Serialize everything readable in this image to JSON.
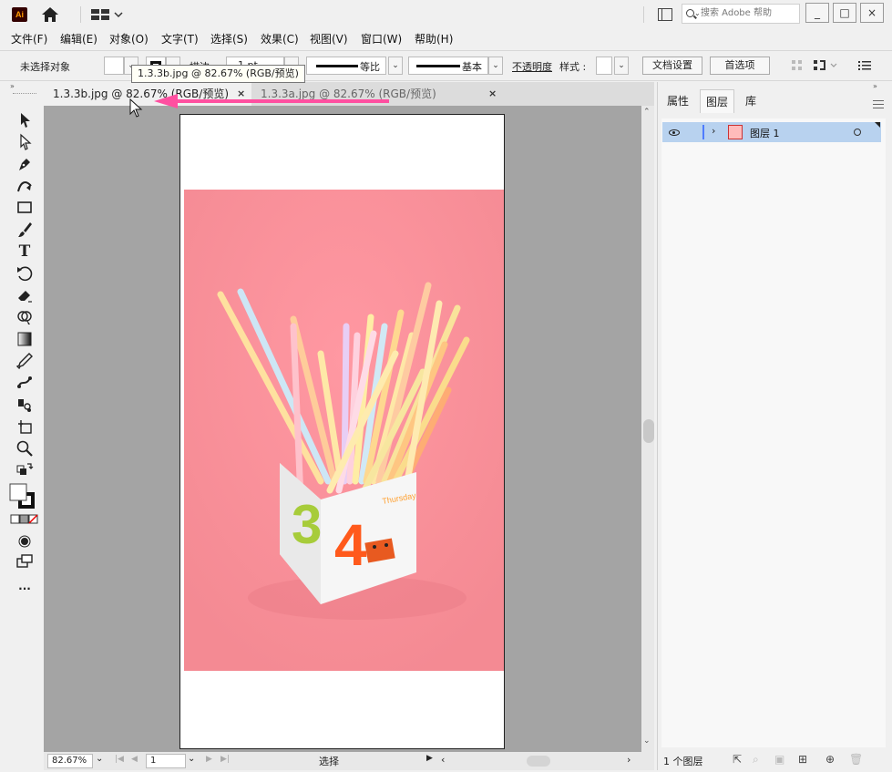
{
  "app": {
    "logo_text": "Ai",
    "search_placeholder": "搜索 Adobe 帮助",
    "window_buttons": [
      "_",
      "□",
      "×"
    ]
  },
  "menu": [
    "文件(F)",
    "编辑(E)",
    "对象(O)",
    "文字(T)",
    "选择(S)",
    "效果(C)",
    "视图(V)",
    "窗口(W)",
    "帮助(H)"
  ],
  "controlbar": {
    "selection_status": "未选择对象",
    "stroke_label": "描边 :",
    "stroke_value": "1 pt",
    "ratio_label": "等比",
    "brush_label": "基本",
    "opacity_label": "不透明度",
    "style_label": "样式 :",
    "doc_setup_button": "文档设置",
    "prefs_button": "首选项"
  },
  "tooltip": "1.3.3b.jpg @ 82.67% (RGB/预览)",
  "tabs": [
    {
      "label": "1.3.3b.jpg @ 82.67% (RGB/预览)",
      "active": true
    },
    {
      "label": "1.3.3a.jpg @ 82.67% (RGB/预览)",
      "active": false
    }
  ],
  "tab_close_glyph": "×",
  "statusbar": {
    "zoom": "82.67%",
    "artboard": "1",
    "tool_status": "选择"
  },
  "rightpanel": {
    "tabs": [
      "属性",
      "图层",
      "库"
    ],
    "active_tab": "图层",
    "layers": [
      {
        "name": "图层 1"
      }
    ],
    "layer_count": "1 个图层"
  },
  "colors": {
    "accent_arrow": "#ff4fa0",
    "layer_selected": "#b8d2ef",
    "canvas_bg": "#a4a4a4"
  },
  "photo_text": {
    "weekday": "Thursday",
    "numeral_left": "3",
    "numeral_right": "4"
  }
}
